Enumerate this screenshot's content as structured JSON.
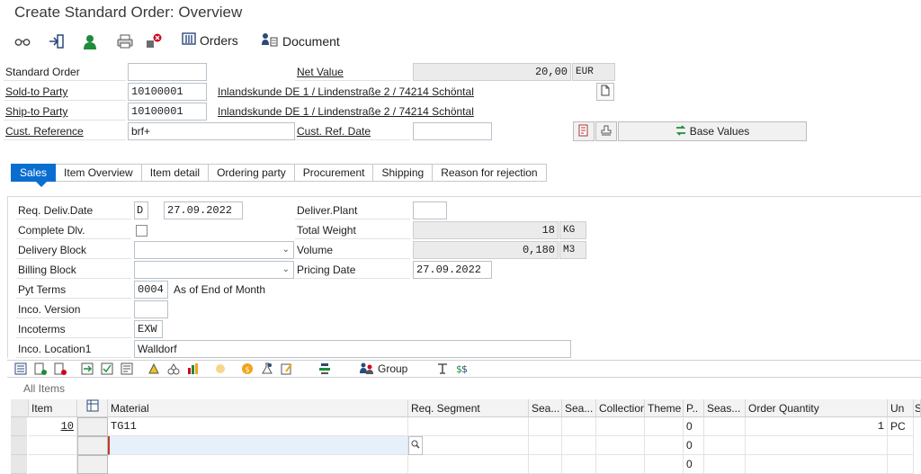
{
  "window": {
    "title": "Create Standard Order: Overview"
  },
  "toolbar": {
    "icons": [
      "glasses-icon",
      "enter-icon",
      "person-icon",
      "print-icon",
      "delete-icon"
    ],
    "orders_label": "Orders",
    "document_label": "Document"
  },
  "header": {
    "standard_order": {
      "label": "Standard Order",
      "value": ""
    },
    "net_value": {
      "label": "Net Value",
      "value": "20,00",
      "currency": "EUR"
    },
    "sold_to": {
      "label": "Sold-to Party",
      "value": "10100001",
      "desc": "Inlandskunde DE 1 / Lindenstraße 2 / 74214 Schöntal"
    },
    "ship_to": {
      "label": "Ship-to Party",
      "value": "10100001",
      "desc": "Inlandskunde DE 1 / Lindenstraße 2 / 74214 Schöntal"
    },
    "cust_ref": {
      "label": "Cust. Reference",
      "value": "brf+"
    },
    "cust_ref_date": {
      "label": "Cust. Ref. Date",
      "value": ""
    },
    "base_values_label": "Base Values"
  },
  "tabs": [
    "Sales",
    "Item Overview",
    "Item detail",
    "Ordering party",
    "Procurement",
    "Shipping",
    "Reason for rejection"
  ],
  "sales": {
    "req_deliv_date": {
      "label": "Req. Deliv.Date",
      "type": "D",
      "value": "27.09.2022"
    },
    "complete_dlv": {
      "label": "Complete Dlv.",
      "checked": false
    },
    "delivery_block": {
      "label": "Delivery Block",
      "value": ""
    },
    "billing_block": {
      "label": "Billing Block",
      "value": ""
    },
    "pyt_terms": {
      "label": "Pyt Terms",
      "value": "0004",
      "desc": "As of End of Month"
    },
    "inco_version": {
      "label": "Inco. Version",
      "value": ""
    },
    "incoterms": {
      "label": "Incoterms",
      "value": "EXW"
    },
    "inco_location1": {
      "label": "Inco. Location1",
      "value": "Walldorf"
    },
    "deliver_plant": {
      "label": "Deliver.Plant",
      "value": ""
    },
    "total_weight": {
      "label": "Total Weight",
      "value": "18",
      "unit": "KG"
    },
    "volume": {
      "label": "Volume",
      "value": "0,180",
      "unit": "M3"
    },
    "pricing_date": {
      "label": "Pricing Date",
      "value": "27.09.2022"
    }
  },
  "items_toolbar": {
    "group_label": "Group"
  },
  "items": {
    "section_label": "All Items",
    "columns": [
      "Item",
      "",
      "Material",
      "Req. Segment",
      "Sea...",
      "Sea...",
      "Collection",
      "Theme",
      "P..",
      "Seas...",
      "Order Quantity",
      "Un",
      "S"
    ],
    "rows": [
      {
        "item": "10",
        "material": "TG11",
        "p": "0",
        "qty": "1",
        "unit": "PC"
      },
      {
        "item": "",
        "material": "",
        "p": "0",
        "qty": "",
        "unit": ""
      },
      {
        "item": "",
        "material": "",
        "p": "0",
        "qty": "",
        "unit": ""
      }
    ]
  },
  "colors": {
    "accent": "#0a6ed1",
    "green": "#1e8c3a"
  }
}
